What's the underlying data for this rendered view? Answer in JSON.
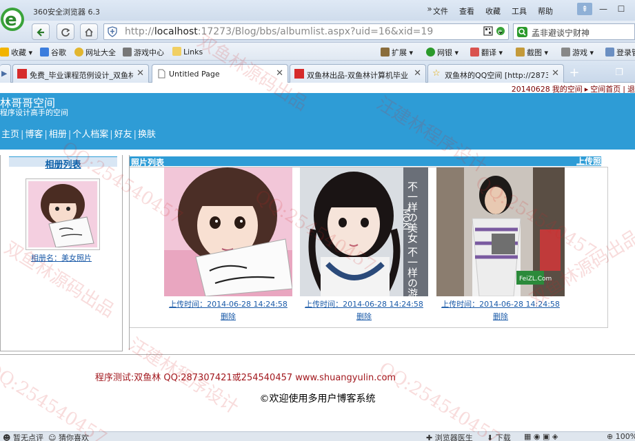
{
  "browser": {
    "title": "360安全浏览器 6.3",
    "menu": [
      "文件",
      "查看",
      "收藏",
      "工具",
      "帮助"
    ],
    "url_prefix": "http://",
    "url_host": "localhost",
    "url_rest": ":17273/Blog/bbs/albumlist.aspx?uid=16&xid=19",
    "search_text": "孟非避谈宁财神",
    "favorites": [
      "收藏",
      "谷歌",
      "网址大全",
      "游戏中心",
      "Links"
    ],
    "tools": [
      "扩展",
      "网银",
      "翻译",
      "截图",
      "游戏",
      "登录管"
    ],
    "tabs": [
      {
        "label": "免费_毕业课程范例设计_双鱼林"
      },
      {
        "label": "Untitled Page"
      },
      {
        "label": "双鱼林出品-双鱼林计算机毕业"
      },
      {
        "label": "双鱼林的QQ空间 [http://2873"
      }
    ],
    "status": {
      "left1": "暂无点评",
      "left2": "猜你喜欢",
      "right1": "浏览器医生",
      "right2": "下载",
      "zoom": "100%"
    }
  },
  "page": {
    "topline": {
      "date": "20140628",
      "my_space": "我的空间",
      "space_home": "空间首页",
      "logout": "退"
    },
    "site_title": "林哥哥空间",
    "site_subtitle": "程序设计高手的空间",
    "nav": [
      "主页",
      "博客",
      "相册",
      "个人档案",
      "好友",
      "换肤"
    ],
    "left": {
      "header": "相册列表",
      "album_caption": "相册名：美女照片"
    },
    "right": {
      "header": "照片列表",
      "upload": "上传照"
    },
    "photos": [
      {
        "upload_time": "上传时间：2014-06-28 14:24:58",
        "delete": "删除"
      },
      {
        "upload_time": "上传时间：2014-06-28 14:24:58",
        "delete": "删除"
      },
      {
        "upload_time": "上传时间：2014-06-28 14:24:58",
        "delete": "删除"
      }
    ],
    "photo_overlay": {
      "vertical_text": "不一样の美女 不一样の游戏",
      "side_text": "MOKI",
      "logo": "FeiZL.Com"
    },
    "footer_line1": "程序测试:双鱼林 QQ:287307421或254540457 www.shuangyulin.com",
    "footer_line2": "©欢迎使用多用户博客系统"
  },
  "watermarks": [
    "双鱼林源码出品",
    "QQ:254540457",
    "汪建林程序设计"
  ],
  "colors": {
    "banner": "#2e9cd6",
    "footer_red": "#a2181e",
    "link": "#1a5aa8"
  }
}
